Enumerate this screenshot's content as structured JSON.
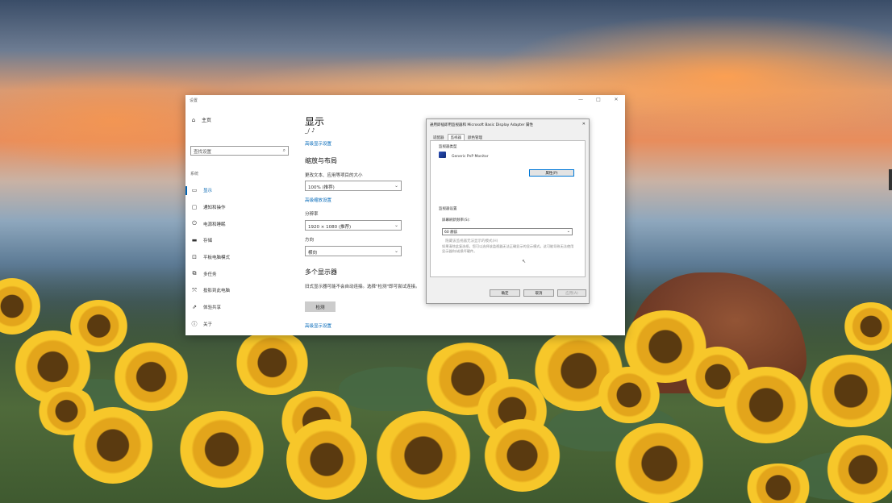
{
  "settings": {
    "window_title": "设置",
    "controls": [
      "—",
      "□",
      "✕"
    ],
    "home_label": "主页",
    "search_placeholder": "查找设置",
    "section_label": "系统",
    "nav_items": [
      {
        "label": "显示",
        "icon": "monitor-icon",
        "active": true
      },
      {
        "label": "通知和操作",
        "icon": "notification-icon",
        "active": false
      },
      {
        "label": "电源和睡眠",
        "icon": "power-icon",
        "active": false
      },
      {
        "label": "存储",
        "icon": "storage-icon",
        "active": false
      },
      {
        "label": "平板电脑模式",
        "icon": "tablet-icon",
        "active": false
      },
      {
        "label": "多任务",
        "icon": "multitask-icon",
        "active": false
      },
      {
        "label": "投影到此电脑",
        "icon": "projector-icon",
        "active": false
      },
      {
        "label": "体验共享",
        "icon": "share-icon",
        "active": false
      },
      {
        "label": "关于",
        "icon": "info-icon",
        "active": false
      }
    ],
    "page_title": "显示",
    "device_line": "_/  ♪",
    "link_detect": "高级显示设置",
    "scale_layout_title": "缩放与布局",
    "scale_label": "更改文本、应用等项目的大小",
    "scale_value": "100% (推荐)",
    "link_custom_scale": "高级缩放设置",
    "resolution_label": "分辨率",
    "resolution_value": "1920 × 1080 (推荐)",
    "orientation_label": "方向",
    "orientation_value": "横向",
    "multi_display_title": "多个显示器",
    "multi_display_desc": "旧式显示器可能不会自动连接。选择\"检测\"即可尝试连接。",
    "detect_button": "检测",
    "link_bottom": "高级显示设置"
  },
  "dialog": {
    "title": "通用即插即用监视器和 Microsoft Basic Display Adapter 属性",
    "close": "✕",
    "tabs": [
      "适配器",
      "监视器",
      "颜色管理"
    ],
    "monitor_type_label": "监视器类型",
    "adapter_name": "Generic PnP Monitor",
    "properties_button": "属性(P)",
    "monitor_settings_label": "监视器设置",
    "refresh_label": "屏幕刷新频率(S):",
    "refresh_value": "60 赫兹",
    "hide_modes_label": "隐藏该监视器无法显示的模式(H)",
    "note": "如果清除此复选框，您可以选择该监视器无法正确显示的显示模式。这可能导致无法使用显示器和/或损坏硬件。",
    "ok_button": "确定",
    "cancel_button": "取消",
    "apply_button": "应用(A)"
  }
}
